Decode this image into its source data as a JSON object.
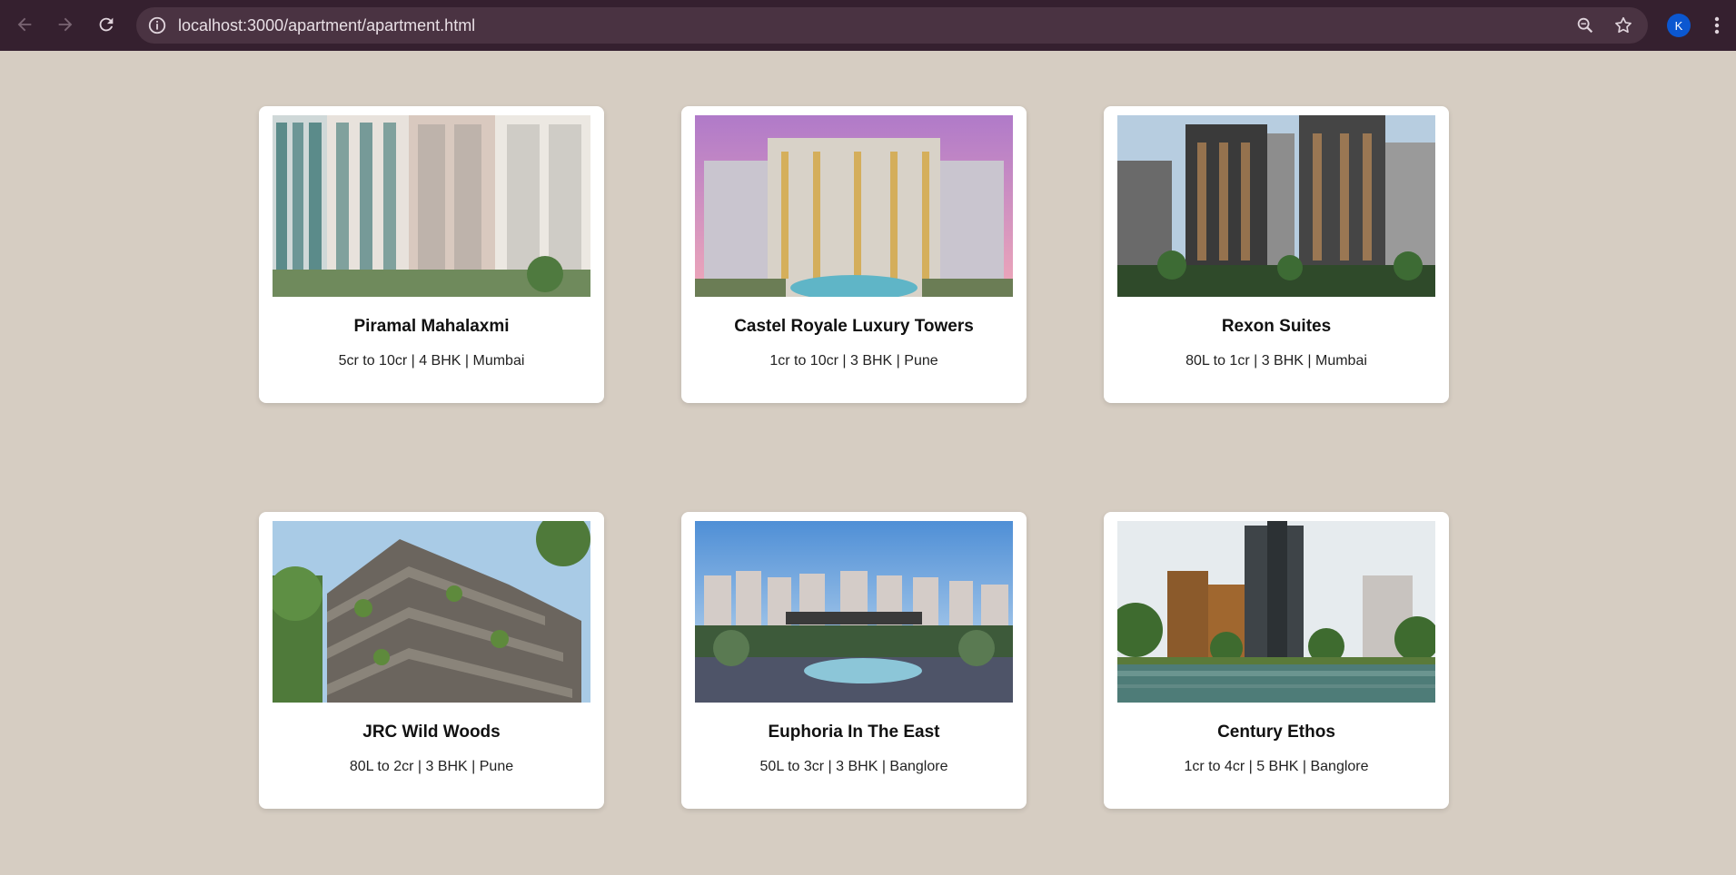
{
  "browser": {
    "url": "localhost:3000/apartment/apartment.html",
    "profile_initial": "K",
    "accent": "#0b57d0"
  },
  "page": {
    "background": "#d6cdc2",
    "cards": [
      {
        "name": "Piramal Mahalaxmi",
        "details": "5cr to 10cr | 4 BHK | Mumbai"
      },
      {
        "name": "Castel Royale Luxury Towers",
        "details": "1cr to 10cr | 3 BHK | Pune"
      },
      {
        "name": "Rexon Suites",
        "details": "80L to 1cr | 3 BHK | Mumbai"
      },
      {
        "name": "JRC Wild Woods",
        "details": "80L to 2cr | 3 BHK | Pune"
      },
      {
        "name": "Euphoria In The East",
        "details": "50L to 3cr | 3 BHK | Banglore"
      },
      {
        "name": "Century Ethos",
        "details": "1cr to 4cr | 5 BHK | Banglore"
      }
    ]
  }
}
